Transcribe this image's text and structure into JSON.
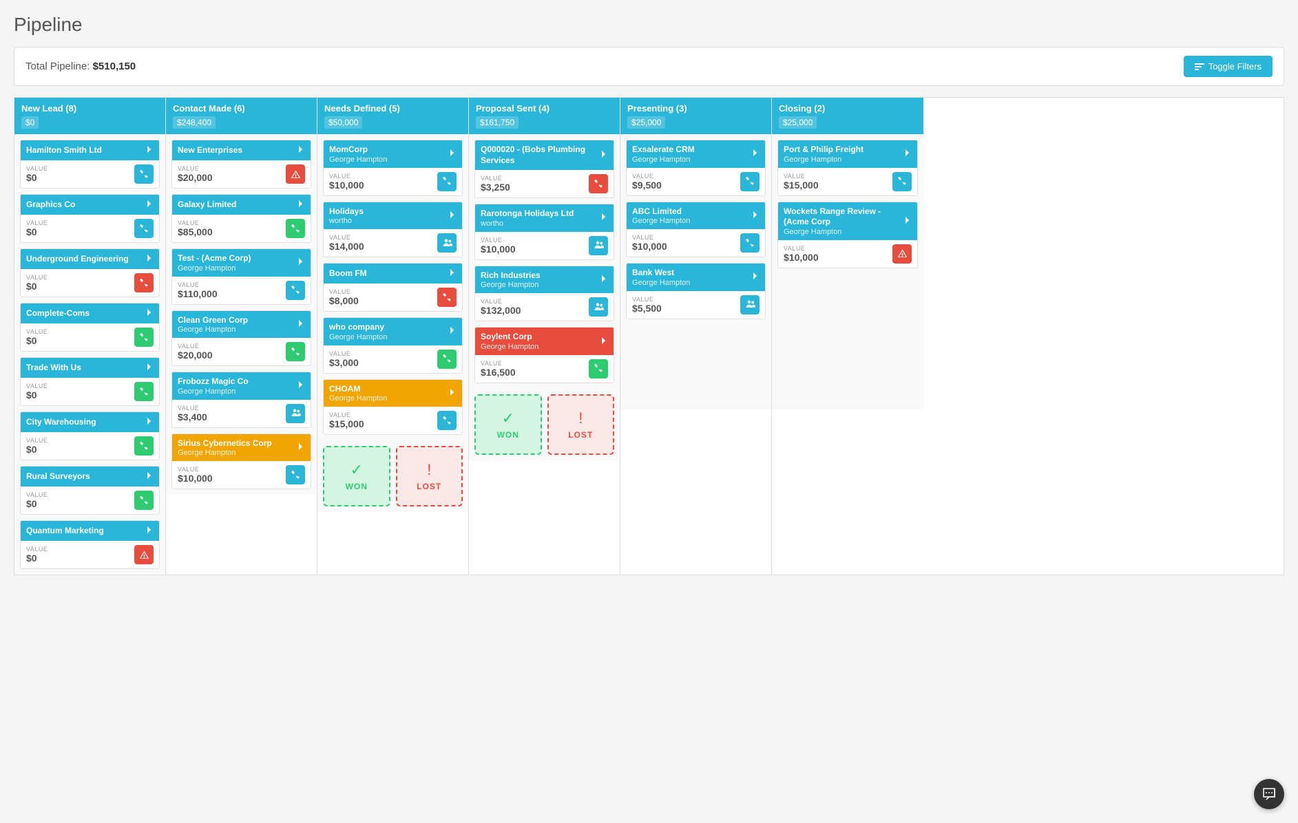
{
  "page": {
    "title": "Pipeline",
    "total_label": "Total Pipeline:",
    "total_value": "$510,150",
    "toggle_filters": "Toggle Filters"
  },
  "columns": [
    {
      "id": "new-lead",
      "title": "New Lead (8)",
      "amount": "$0",
      "cards": [
        {
          "id": "hamilton-smith",
          "title": "Hamilton Smith Ltd",
          "subtitle": "",
          "value": "$0",
          "icon": "phone",
          "icon_type": "blue",
          "header_color": "blue"
        },
        {
          "id": "graphics-co",
          "title": "Graphics Co",
          "subtitle": "",
          "value": "$0",
          "icon": "phone",
          "icon_type": "blue",
          "header_color": "blue"
        },
        {
          "id": "underground-eng",
          "title": "Underground Engineering",
          "subtitle": "",
          "value": "$0",
          "icon": "phone",
          "icon_type": "red",
          "header_color": "blue"
        },
        {
          "id": "complete-coms",
          "title": "Complete-Coms",
          "subtitle": "",
          "value": "$0",
          "icon": "phone",
          "icon_type": "green",
          "header_color": "blue"
        },
        {
          "id": "trade-with-us",
          "title": "Trade With Us",
          "subtitle": "",
          "value": "$0",
          "icon": "phone",
          "icon_type": "green",
          "header_color": "blue"
        },
        {
          "id": "city-warehousing",
          "title": "City Warehousing",
          "subtitle": "",
          "value": "$0",
          "icon": "phone",
          "icon_type": "green",
          "header_color": "blue"
        },
        {
          "id": "rural-surveyors",
          "title": "Rural Surveyors",
          "subtitle": "",
          "value": "$0",
          "icon": "phone",
          "icon_type": "green",
          "header_color": "blue"
        },
        {
          "id": "quantum-marketing",
          "title": "Quantum Marketing",
          "subtitle": "",
          "value": "$0",
          "icon": "alert",
          "icon_type": "red",
          "header_color": "blue"
        }
      ]
    },
    {
      "id": "contact-made",
      "title": "Contact Made (6)",
      "amount": "$248,400",
      "cards": [
        {
          "id": "new-enterprises",
          "title": "New Enterprises",
          "subtitle": "",
          "value": "$20,000",
          "icon": "alert",
          "icon_type": "red",
          "header_color": "blue"
        },
        {
          "id": "galaxy-limited",
          "title": "Galaxy Limited",
          "subtitle": "",
          "value": "$85,000",
          "icon": "phone",
          "icon_type": "green",
          "header_color": "blue"
        },
        {
          "id": "test-acme",
          "title": "Test - (Acme Corp)",
          "subtitle": "George Hampton",
          "value": "$110,000",
          "icon": "phone",
          "icon_type": "blue",
          "header_color": "blue"
        },
        {
          "id": "clean-green-corp",
          "title": "Clean Green Corp",
          "subtitle": "George Hampton",
          "value": "$20,000",
          "icon": "phone",
          "icon_type": "green",
          "header_color": "blue"
        },
        {
          "id": "frobozz-magic",
          "title": "Frobozz Magic Co",
          "subtitle": "George Hampton",
          "value": "$3,400",
          "icon": "people",
          "icon_type": "blue",
          "header_color": "blue"
        },
        {
          "id": "sirius-cybernetics",
          "title": "Sirius Cybernetics Corp",
          "subtitle": "George Hampton",
          "value": "$10,000",
          "icon": "phone",
          "icon_type": "blue",
          "header_color": "orange"
        }
      ]
    },
    {
      "id": "needs-defined",
      "title": "Needs Defined (5)",
      "amount": "$50,000",
      "cards": [
        {
          "id": "momcorp",
          "title": "MomCorp",
          "subtitle": "George Hampton",
          "value": "$10,000",
          "icon": "phone",
          "icon_type": "blue",
          "header_color": "blue"
        },
        {
          "id": "holidays",
          "title": "Holidays",
          "subtitle": "wortho",
          "value": "$14,000",
          "icon": "people",
          "icon_type": "blue",
          "header_color": "blue"
        },
        {
          "id": "boom-fm",
          "title": "Boom FM",
          "subtitle": "",
          "value": "$8,000",
          "icon": "phone",
          "icon_type": "red",
          "header_color": "blue"
        },
        {
          "id": "who-company",
          "title": "who company",
          "subtitle": "George Hampton",
          "value": "$3,000",
          "icon": "phone",
          "icon_type": "green",
          "header_color": "blue"
        },
        {
          "id": "choam",
          "title": "CHOAM",
          "subtitle": "George Hampton",
          "value": "$15,000",
          "icon": "phone",
          "icon_type": "blue",
          "header_color": "orange"
        }
      ],
      "drop_zones": true
    },
    {
      "id": "proposal-sent",
      "title": "Proposal Sent (4)",
      "amount": "$161,750",
      "cards": [
        {
          "id": "q000020-bobs",
          "title": "Q000020 - (Bobs Plumbing Services",
          "subtitle": "",
          "value": "$3,250",
          "icon": "phone",
          "icon_type": "red",
          "header_color": "blue"
        },
        {
          "id": "rarotonga-holidays",
          "title": "Rarotonga Holidays Ltd",
          "subtitle": "wortho",
          "value": "$10,000",
          "icon": "people",
          "icon_type": "blue",
          "header_color": "blue"
        },
        {
          "id": "rich-industries",
          "title": "Rich Industries",
          "subtitle": "George Hampton",
          "value": "$132,000",
          "icon": "people",
          "icon_type": "blue",
          "header_color": "blue"
        },
        {
          "id": "soylent-corp",
          "title": "Soylent Corp",
          "subtitle": "George Hampton",
          "value": "$16,500",
          "icon": "phone",
          "icon_type": "green",
          "header_color": "red"
        }
      ],
      "drop_zones": true
    },
    {
      "id": "presenting",
      "title": "Presenting (3)",
      "amount": "$25,000",
      "cards": [
        {
          "id": "exsalerate-crm",
          "title": "Exsalerate CRM",
          "subtitle": "George Hampton",
          "value": "$9,500",
          "icon": "phone",
          "icon_type": "blue",
          "header_color": "blue"
        },
        {
          "id": "abc-limited",
          "title": "ABC Limited",
          "subtitle": "George Hampton",
          "value": "$10,000",
          "icon": "phone",
          "icon_type": "blue",
          "header_color": "blue"
        },
        {
          "id": "bank-west",
          "title": "Bank West",
          "subtitle": "George Hampton",
          "value": "$5,500",
          "icon": "people",
          "icon_type": "blue",
          "header_color": "blue"
        }
      ]
    },
    {
      "id": "closing",
      "title": "Closing (2)",
      "amount": "$25,000",
      "cards": [
        {
          "id": "port-philip-freight",
          "title": "Port & Philip Freight",
          "subtitle": "George Hampton",
          "value": "$15,000",
          "icon": "phone",
          "icon_type": "blue",
          "header_color": "blue"
        },
        {
          "id": "wockets-range-review",
          "title": "Wockets Range Review - (Acme Corp",
          "subtitle": "George Hampton",
          "value": "$10,000",
          "icon": "alert",
          "icon_type": "red",
          "header_color": "blue"
        }
      ]
    }
  ],
  "drop_zones": {
    "won_label": "WON",
    "lost_label": "LOST"
  },
  "chat": {
    "label": "Chat"
  }
}
